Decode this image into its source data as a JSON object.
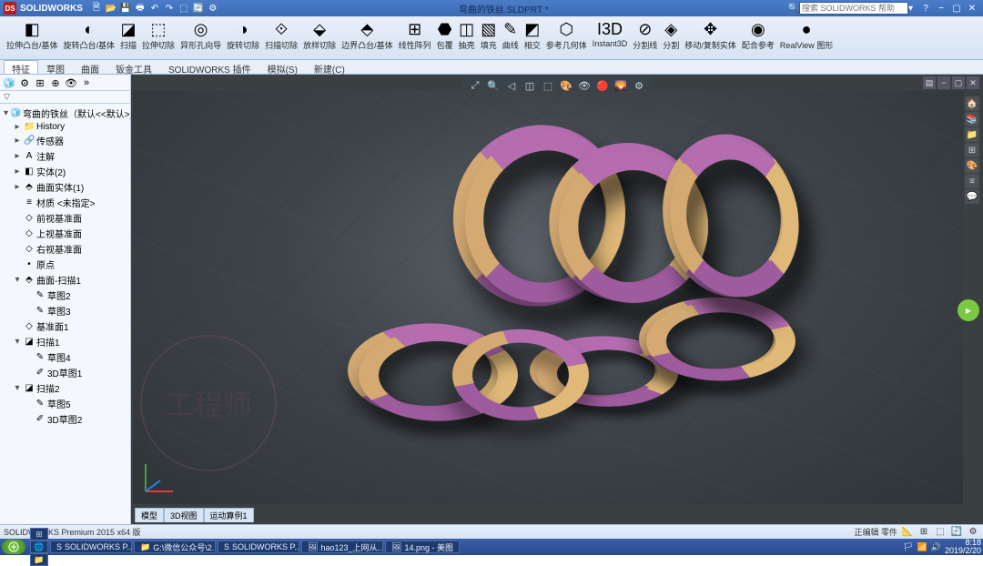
{
  "app": {
    "name": "SOLIDWORKS",
    "docTitle": "弯曲的铁丝.SLDPRT *"
  },
  "search": {
    "placeholder": "搜索 SOLIDWORKS 帮助"
  },
  "ribbon": [
    {
      "icon": "◧",
      "label": "拉伸凸台/基体"
    },
    {
      "icon": "◐",
      "label": "旋转凸台/基体"
    },
    {
      "icon": "◪",
      "label": "扫描"
    },
    {
      "icon": "⬚",
      "label": "拉伸切除"
    },
    {
      "icon": "◎",
      "label": "异形孔向导"
    },
    {
      "icon": "◑",
      "label": "旋转切除"
    },
    {
      "icon": "⟐",
      "label": "扫描切除"
    },
    {
      "icon": "⬙",
      "label": "放样切除"
    },
    {
      "icon": "⬘",
      "label": "边界凸台/基体"
    },
    {
      "icon": "⊞",
      "label": "线性阵列"
    },
    {
      "icon": "⬣",
      "label": "包覆"
    },
    {
      "icon": "◫",
      "label": "抽壳"
    },
    {
      "icon": "▧",
      "label": "填充"
    },
    {
      "icon": "✎",
      "label": "曲线"
    },
    {
      "icon": "◩",
      "label": "相交"
    },
    {
      "icon": "⬡",
      "label": "参考几何体"
    },
    {
      "icon": "I3D",
      "label": "Instant3D"
    },
    {
      "icon": "⊘",
      "label": "分割线"
    },
    {
      "icon": "◈",
      "label": "分割"
    },
    {
      "icon": "✥",
      "label": "移动/复制实体"
    },
    {
      "icon": "◉",
      "label": "配合参考"
    },
    {
      "icon": "●",
      "label": "RealView 图形"
    }
  ],
  "tabs": [
    "特征",
    "草图",
    "曲面",
    "钣金工具",
    "SOLIDWORKS 插件",
    "模拟(S)",
    "新建(C)"
  ],
  "activeTab": 0,
  "tree": {
    "root": "弯曲的铁丝（默认<<默认>_显...",
    "items": [
      {
        "ind": 1,
        "exp": "▸",
        "ico": "📁",
        "label": "History"
      },
      {
        "ind": 1,
        "exp": "▸",
        "ico": "🔗",
        "label": "传感器"
      },
      {
        "ind": 1,
        "exp": "▸",
        "ico": "A",
        "label": "注解"
      },
      {
        "ind": 1,
        "exp": "▸",
        "ico": "◧",
        "label": "实体(2)"
      },
      {
        "ind": 1,
        "exp": "▸",
        "ico": "⬘",
        "label": "曲面实体(1)"
      },
      {
        "ind": 1,
        "exp": "",
        "ico": "≡",
        "label": "材质 <未指定>"
      },
      {
        "ind": 1,
        "exp": "",
        "ico": "◇",
        "label": "前视基准面"
      },
      {
        "ind": 1,
        "exp": "",
        "ico": "◇",
        "label": "上视基准面"
      },
      {
        "ind": 1,
        "exp": "",
        "ico": "◇",
        "label": "右视基准面"
      },
      {
        "ind": 1,
        "exp": "",
        "ico": "•",
        "label": "原点"
      },
      {
        "ind": 1,
        "exp": "▾",
        "ico": "⬘",
        "label": "曲面-扫描1"
      },
      {
        "ind": 2,
        "exp": "",
        "ico": "✎",
        "label": "草图2"
      },
      {
        "ind": 2,
        "exp": "",
        "ico": "✎",
        "label": "草图3"
      },
      {
        "ind": 1,
        "exp": "",
        "ico": "◇",
        "label": "基准面1"
      },
      {
        "ind": 1,
        "exp": "▾",
        "ico": "◪",
        "label": "扫描1"
      },
      {
        "ind": 2,
        "exp": "",
        "ico": "✎",
        "label": "草图4"
      },
      {
        "ind": 2,
        "exp": "",
        "ico": "✐",
        "label": "3D草图1"
      },
      {
        "ind": 1,
        "exp": "▾",
        "ico": "◪",
        "label": "扫描2"
      },
      {
        "ind": 2,
        "exp": "",
        "ico": "✎",
        "label": "草图5"
      },
      {
        "ind": 2,
        "exp": "",
        "ico": "✐",
        "label": "3D草图2"
      }
    ]
  },
  "bottomTabs": [
    "模型",
    "3D视图",
    "运动算例1"
  ],
  "status": {
    "left": "SOLIDWORKS Premium 2015 x64 版",
    "right": "正编辑 零件"
  },
  "taskbar": {
    "pinned": [
      "⊞",
      "🌐",
      "📁"
    ],
    "tasks": [
      {
        "ico": "S",
        "label": "SOLIDWORKS P..."
      },
      {
        "ico": "📁",
        "label": "G:\\微信公众号\\2..."
      },
      {
        "ico": "S",
        "label": "SOLIDWORKS P..."
      },
      {
        "ico": "🖼",
        "label": "hao123_上网从..."
      },
      {
        "ico": "🖼",
        "label": "14.png - 美图"
      }
    ],
    "clock": {
      "time": "8:18",
      "date": "2019/2/20"
    }
  }
}
